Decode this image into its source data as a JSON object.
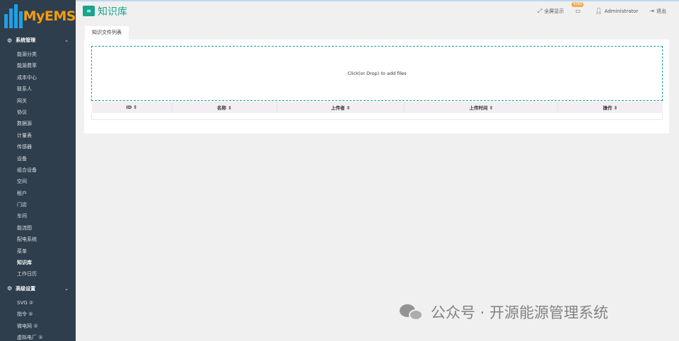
{
  "brand": {
    "name": "MyEMS"
  },
  "sidebar": {
    "groups": [
      {
        "label": "系统管理",
        "items": [
          "能源分类",
          "能源费率",
          "成本中心",
          "联系人",
          "网关",
          "协议",
          "数据源",
          "计量表",
          "传感器",
          "设备",
          "组合设备",
          "空间",
          "租户",
          "门店",
          "车间",
          "能流图",
          "配电系统",
          "菜单",
          "知识库",
          "工作日历"
        ],
        "active_index": 18
      },
      {
        "label": "高级设置",
        "items": [
          "SVG ②",
          "指令 ⑤",
          "微电网 ②",
          "虚拟电厂 ②"
        ]
      }
    ]
  },
  "header": {
    "title": "知识库",
    "fullscreen_label": "全屏显示",
    "notification_count": "4080",
    "user_label": "Administrator",
    "logout_label": "退出"
  },
  "main": {
    "tab_label": "知识文件列表",
    "dropzone_text": "Click(or Drop) to add files",
    "table": {
      "columns": [
        "ID ⇕",
        "名称 ⇕",
        "上传者 ⇕",
        "上传时间 ⇕",
        "操作 ⇕"
      ]
    }
  },
  "watermark": {
    "text": "公众号 · 开源能源管理系统"
  },
  "colors": {
    "sidebar_bg": "#2f3e4c",
    "accent": "#1aa48a",
    "brand_orange": "#f39c12"
  }
}
